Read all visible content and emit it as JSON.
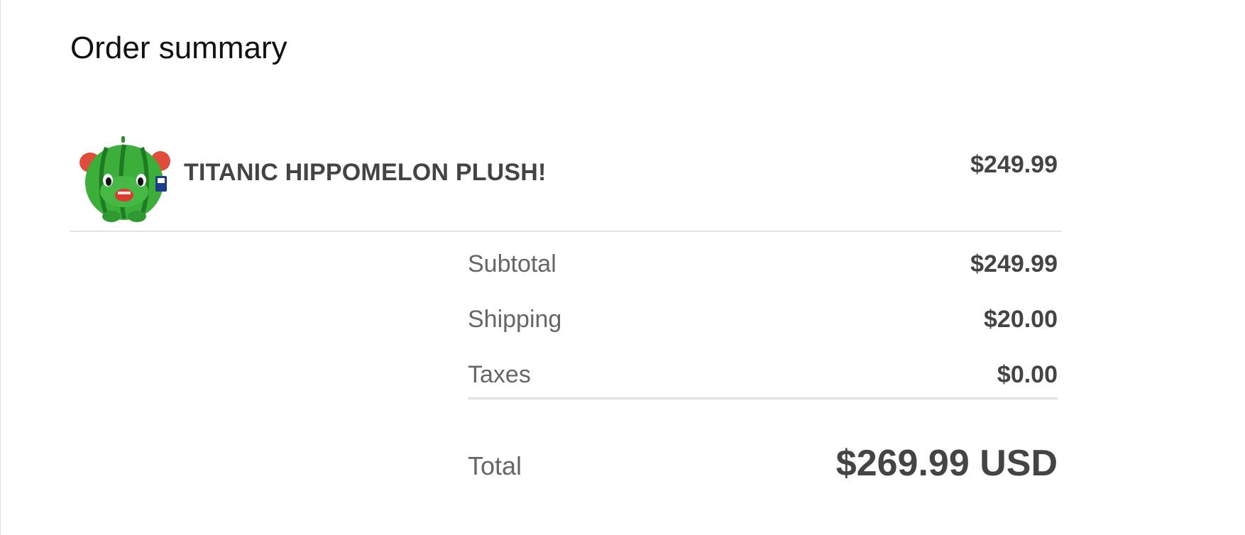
{
  "order_summary": {
    "title": "Order summary",
    "line_items": [
      {
        "name": "TITANIC HIPPOMELON PLUSH!",
        "price": "$249.99",
        "thumbnail_icon": "watermelon-hippo-plush-image"
      }
    ],
    "subtotal_label": "Subtotal",
    "subtotal_value": "$249.99",
    "shipping_label": "Shipping",
    "shipping_value": "$20.00",
    "taxes_label": "Taxes",
    "taxes_value": "$0.00",
    "total_label": "Total",
    "total_value": "$269.99 USD"
  }
}
